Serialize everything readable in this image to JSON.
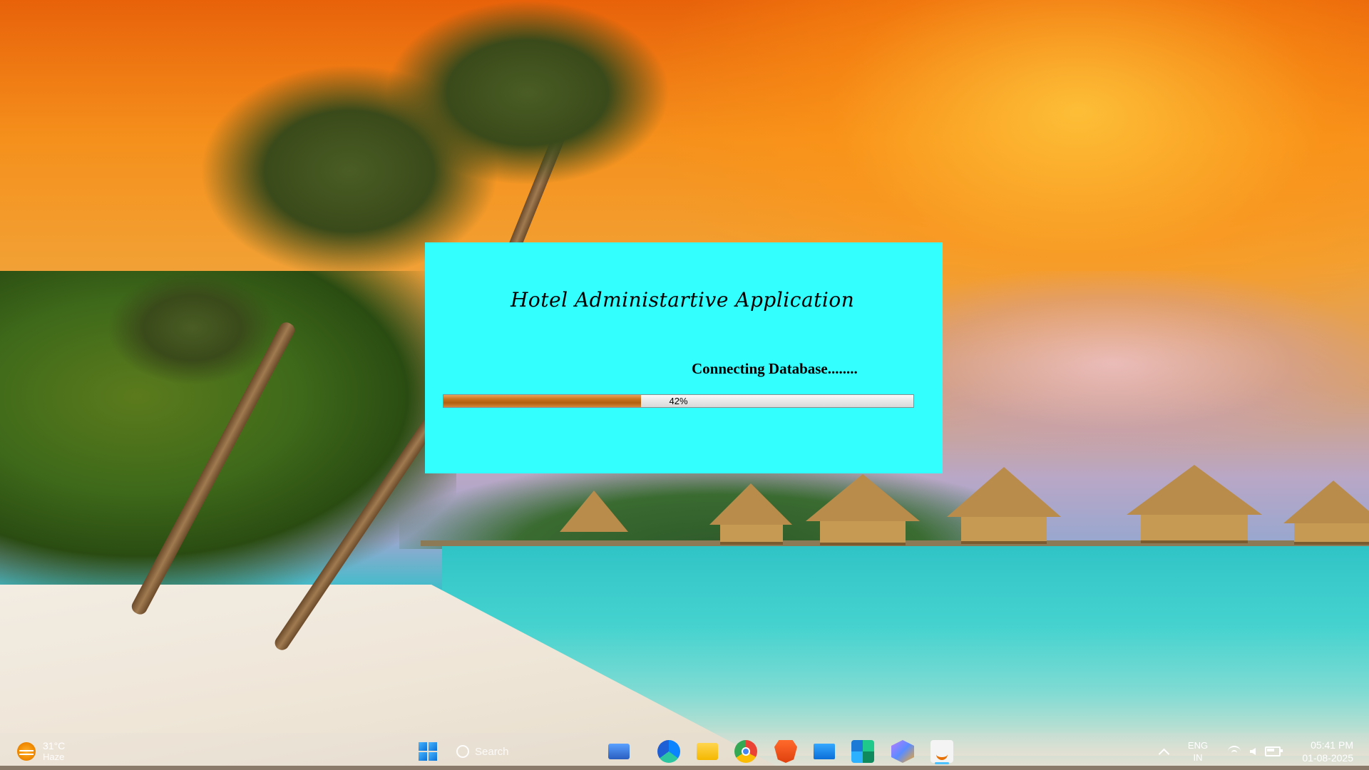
{
  "splash": {
    "title": "Hotel Administartive Application",
    "status": "Connecting Database........",
    "progress_percent": 42,
    "progress_label": "42%",
    "background_color": "#33ffff",
    "progress_fill_color": "#c8731e"
  },
  "taskbar": {
    "weather": {
      "temperature": "31°C",
      "condition": "Haze",
      "icon": "sun-haze-icon"
    },
    "search_label": "Search",
    "pinned_apps": [
      {
        "name": "desktop-app",
        "icon": "computer-icon"
      },
      {
        "name": "edge",
        "icon": "edge-icon"
      },
      {
        "name": "file-explorer",
        "icon": "folder-icon"
      },
      {
        "name": "chrome",
        "icon": "chrome-icon"
      },
      {
        "name": "brave",
        "icon": "brave-icon"
      },
      {
        "name": "remote-desktop",
        "icon": "monitor-icon"
      },
      {
        "name": "puzzle-app",
        "icon": "puzzle-icon"
      },
      {
        "name": "hex-app",
        "icon": "hexagon-icon"
      },
      {
        "name": "java",
        "icon": "java-icon"
      }
    ],
    "tray": {
      "language_line1": "ENG",
      "language_line2": "IN",
      "time": "05:41 PM",
      "date": "01-08-2025"
    }
  }
}
